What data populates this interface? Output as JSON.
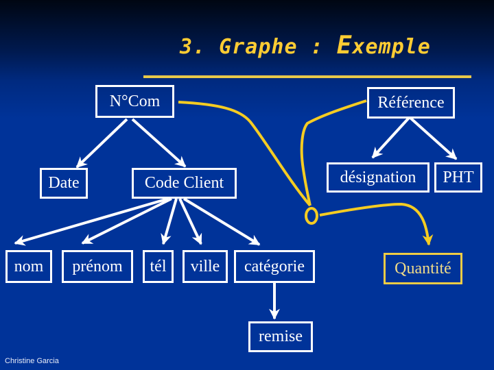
{
  "slide": {
    "title_prefix": "3. Graphe : ",
    "title_big_letter": "E",
    "title_rest": "xemple",
    "footer": "Christine Garcia"
  },
  "colors": {
    "background": "#003399",
    "node_border": "#ffffff",
    "accent": "#ffcc33",
    "highlight_border": "#f0cc44"
  },
  "nodes": {
    "ncom": "N°Com",
    "reference": "Référence",
    "date": "Date",
    "code_client": "Code Client",
    "designation": "désignation",
    "pht": "PHT",
    "nom": "nom",
    "prenom": "prénom",
    "tel": "tél",
    "ville": "ville",
    "categorie": "catégorie",
    "quantite": "Quantité",
    "remise": "remise"
  },
  "edges": [
    {
      "from": "N°Com",
      "to": "Date",
      "type": "functional-dependency"
    },
    {
      "from": "N°Com",
      "to": "Code Client",
      "type": "functional-dependency"
    },
    {
      "from": "Référence",
      "to": "désignation",
      "type": "functional-dependency"
    },
    {
      "from": "Référence",
      "to": "PHT",
      "type": "functional-dependency"
    },
    {
      "from": "Code Client",
      "to": "nom",
      "type": "functional-dependency"
    },
    {
      "from": "Code Client",
      "to": "prénom",
      "type": "functional-dependency"
    },
    {
      "from": "Code Client",
      "to": "tél",
      "type": "functional-dependency"
    },
    {
      "from": "Code Client",
      "to": "ville",
      "type": "functional-dependency"
    },
    {
      "from": "Code Client",
      "to": "catégorie",
      "type": "functional-dependency"
    },
    {
      "from": "catégorie",
      "to": "remise",
      "type": "functional-dependency"
    },
    {
      "from": [
        "N°Com",
        "Référence"
      ],
      "to": "Quantité",
      "type": "composite-dependency"
    }
  ]
}
